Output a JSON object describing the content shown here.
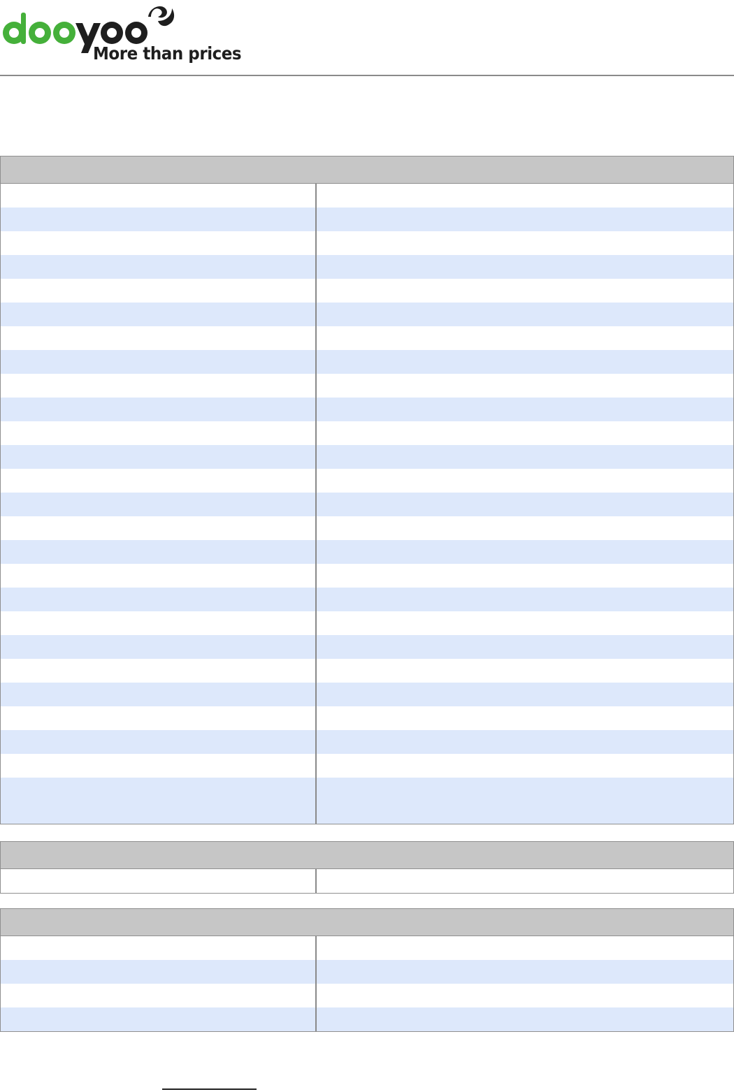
{
  "brand": {
    "logo_text": "dooyoo",
    "tagline": "More than prices",
    "colors": {
      "green": "#45b03a",
      "dark": "#1e1e1e",
      "header_gray": "#c6c6c6",
      "stripe_blue": "#dde8fb",
      "border": "#8f8f8f"
    }
  },
  "tables": [
    {
      "title": "",
      "rows": [
        {
          "label": "",
          "value": ""
        },
        {
          "label": "",
          "value": ""
        },
        {
          "label": "",
          "value": ""
        },
        {
          "label": "",
          "value": ""
        },
        {
          "label": "",
          "value": ""
        },
        {
          "label": "",
          "value": ""
        },
        {
          "label": "",
          "value": ""
        },
        {
          "label": "",
          "value": ""
        },
        {
          "label": "",
          "value": ""
        },
        {
          "label": "",
          "value": ""
        },
        {
          "label": "",
          "value": ""
        },
        {
          "label": "",
          "value": ""
        },
        {
          "label": "",
          "value": ""
        },
        {
          "label": "",
          "value": ""
        },
        {
          "label": "",
          "value": ""
        },
        {
          "label": "",
          "value": ""
        },
        {
          "label": "",
          "value": ""
        },
        {
          "label": "",
          "value": ""
        },
        {
          "label": "",
          "value": ""
        },
        {
          "label": "",
          "value": ""
        },
        {
          "label": "",
          "value": ""
        },
        {
          "label": "",
          "value": ""
        },
        {
          "label": "",
          "value": ""
        },
        {
          "label": "",
          "value": ""
        },
        {
          "label": "",
          "value": ""
        },
        {
          "label": "",
          "value": ""
        }
      ]
    },
    {
      "title": "",
      "rows": [
        {
          "label": "",
          "value": ""
        }
      ]
    },
    {
      "title": "",
      "rows": [
        {
          "label": "",
          "value": ""
        },
        {
          "label": "",
          "value": ""
        },
        {
          "label": "",
          "value": ""
        },
        {
          "label": "",
          "value": ""
        }
      ]
    }
  ],
  "footer": {
    "link_text": ""
  }
}
